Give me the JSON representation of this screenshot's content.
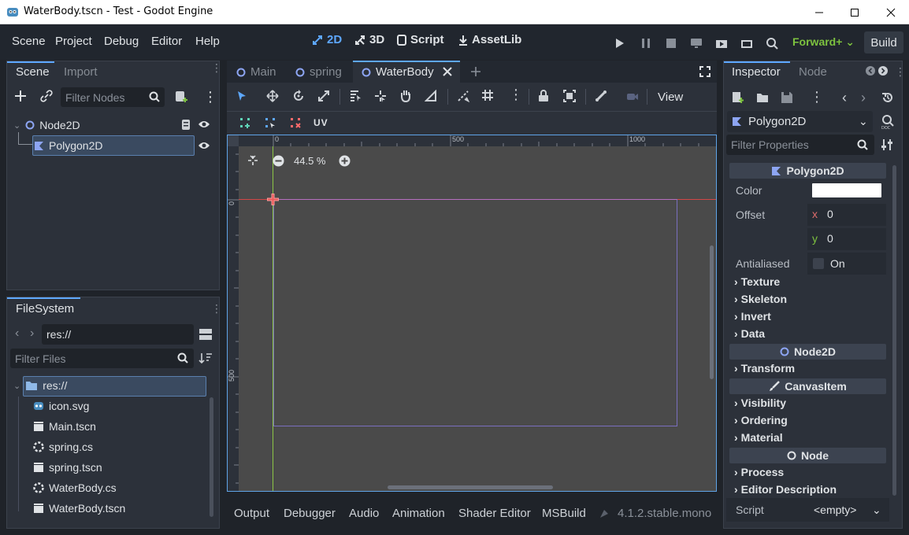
{
  "window": {
    "title": "WaterBody.tscn - Test - Godot Engine"
  },
  "menu": {
    "items": [
      "Scene",
      "Project",
      "Debug",
      "Editor",
      "Help"
    ]
  },
  "workspaces": {
    "items": [
      "2D",
      "3D",
      "Script",
      "AssetLib"
    ],
    "active": "2D"
  },
  "toolbar": {
    "renderer": "Forward+",
    "build_label": "Build"
  },
  "scene_dock": {
    "tabs": [
      "Scene",
      "Import"
    ],
    "filter_placeholder": "Filter Nodes",
    "tree": [
      {
        "label": "Node2D",
        "icon": "node2d-icon"
      },
      {
        "label": "Polygon2D",
        "icon": "polygon2d-icon",
        "selected": true
      }
    ]
  },
  "filesystem": {
    "tab": "FileSystem",
    "path": "res://",
    "filter_placeholder": "Filter Files",
    "root": "res://",
    "files": [
      {
        "name": "icon.svg",
        "icon": "godot-icon"
      },
      {
        "name": "Main.tscn",
        "icon": "clapper-icon"
      },
      {
        "name": "spring.cs",
        "icon": "csharp-icon"
      },
      {
        "name": "spring.tscn",
        "icon": "clapper-icon"
      },
      {
        "name": "WaterBody.cs",
        "icon": "csharp-icon"
      },
      {
        "name": "WaterBody.tscn",
        "icon": "clapper-icon"
      }
    ]
  },
  "editor_tabs": {
    "items": [
      "Main",
      "spring",
      "WaterBody"
    ],
    "active": "WaterBody"
  },
  "viewport": {
    "view_label": "View",
    "uv_label": "UV",
    "zoom": "44.5 %",
    "ruler_top": [
      "0",
      "500",
      "1000"
    ],
    "ruler_left": [
      "0",
      "500"
    ]
  },
  "bottom_panel": {
    "tabs": [
      "Output",
      "Debugger",
      "Audio",
      "Animation",
      "Shader Editor",
      "MSBuild"
    ],
    "version": "4.1.2.stable.mono"
  },
  "inspector": {
    "tabs": [
      "Inspector",
      "Node"
    ],
    "node_name": "Polygon2D",
    "filter_placeholder": "Filter Properties",
    "polygon2d": {
      "header": "Polygon2D",
      "color_label": "Color",
      "color_value": "#ffffff",
      "offset_label": "Offset",
      "offset_x_label": "x",
      "offset_x": "0",
      "offset_y_label": "y",
      "offset_y": "0",
      "antialiased_label": "Antialiased",
      "antialiased_value": "On",
      "groups": [
        "Texture",
        "Skeleton",
        "Invert",
        "Data"
      ]
    },
    "node2d": {
      "header": "Node2D",
      "groups": [
        "Transform"
      ]
    },
    "canvasitem": {
      "header": "CanvasItem",
      "groups": [
        "Visibility",
        "Ordering",
        "Material"
      ]
    },
    "node": {
      "header": "Node",
      "groups": [
        "Process",
        "Editor Description"
      ]
    },
    "script_label": "Script",
    "script_value": "<empty>"
  },
  "colors": {
    "accent": "#5ea8ff",
    "renderer": "#7dc23f",
    "selection": "#3a4a60"
  }
}
